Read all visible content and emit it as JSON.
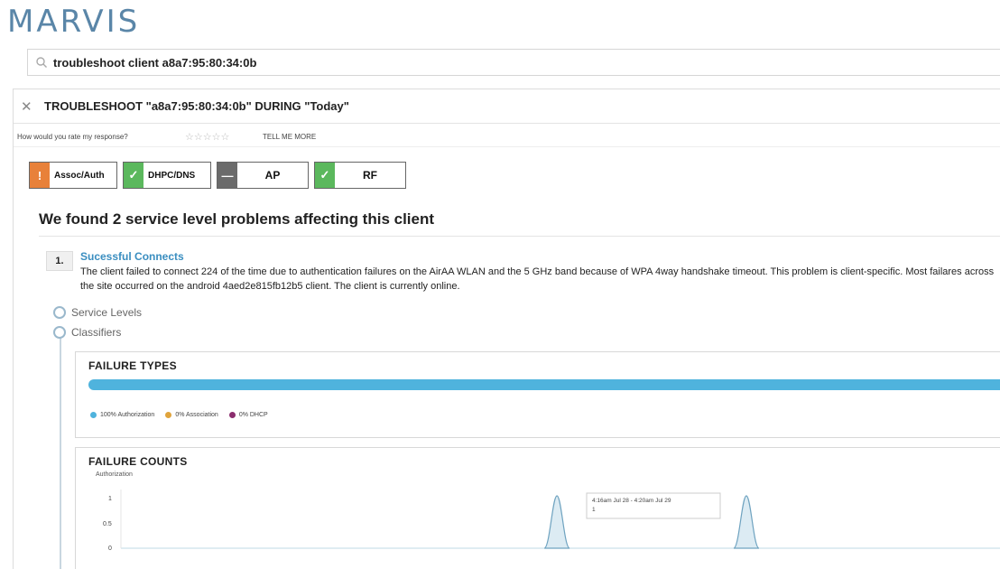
{
  "app": {
    "logo": "MARVIS"
  },
  "search": {
    "query": "troubleshoot client a8a7:95:80:34:0b",
    "icon": "search-icon"
  },
  "troubleshoot": {
    "title": "TROUBLESHOOT \"a8a7:95:80:34:0b\" DURING \"Today\"",
    "rate_question": "How would you rate my response?",
    "stars": "☆☆☆☆☆",
    "tell_more": "TELL ME MORE"
  },
  "categories": [
    {
      "label": "Assoc/Auth",
      "status": "warning",
      "badge": "!",
      "color": "#e8813a"
    },
    {
      "label": "DHPC/DNS",
      "status": "ok",
      "badge": "✓",
      "color": "#5bb85d"
    },
    {
      "label": "AP",
      "status": "none",
      "badge": "—",
      "color": "#6b6b6b"
    },
    {
      "label": "RF",
      "status": "ok",
      "badge": "✓",
      "color": "#5bb85d"
    }
  ],
  "summary": "We found 2 service level problems affecting this client",
  "problem": {
    "number": "1.",
    "title": "Sucessful Connects",
    "description": "The client failed to connect 224 of the time due to authentication failures on the AirAA WLAN and the 5 GHz band because of WPA 4way handshake timeout. This problem is client-specific. Most failares across the site occurred on the android 4aed2e815fb12b5 client. The client is currently online."
  },
  "tree": {
    "service_levels": "Service Levels",
    "classifiers": "Classifiers"
  },
  "failure_types": {
    "title": "FAILURE TYPES",
    "legend": [
      {
        "label": "100% Authorization",
        "color": "#4fb3dd"
      },
      {
        "label": "0% Association",
        "color": "#e0a43c"
      },
      {
        "label": "0% DHCP",
        "color": "#8b2d6e"
      }
    ]
  },
  "failure_counts": {
    "title": "FAILURE COUNTS",
    "subtitle": "Authorization",
    "tooltip_line1": "4:16am Jul 28 - 4:20am Jul 29",
    "tooltip_line2": "1"
  },
  "chart_data": {
    "type": "area",
    "ylabel": "Authorization",
    "ylim": [
      0,
      1
    ],
    "yticks": [
      "1",
      "0.5",
      "0"
    ],
    "series": [
      {
        "peaks": [
          0.495,
          0.71
        ],
        "values": [
          1,
          1
        ]
      }
    ]
  }
}
